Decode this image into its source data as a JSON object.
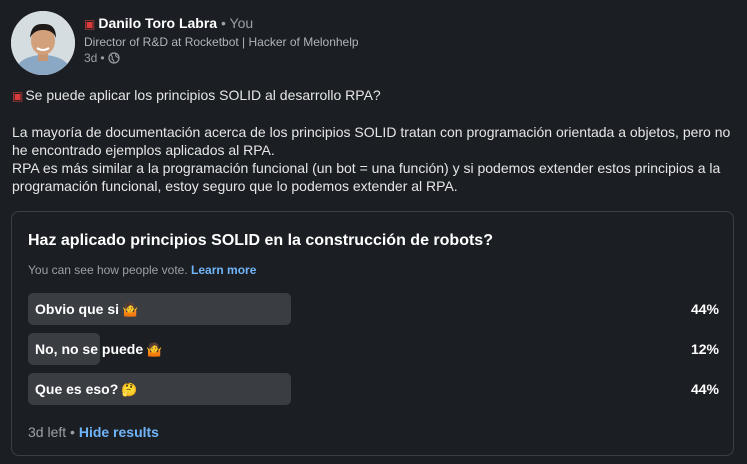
{
  "author": {
    "badge_icon": "robot-icon",
    "name": "Danilo Toro Labra",
    "separator": "•",
    "relation": "You",
    "headline": "Director of R&D at Rocketbot | Hacker of Melonhelp",
    "time": "3d",
    "visibility_icon": "globe-icon"
  },
  "post": {
    "question_icon": "robot-icon",
    "question": "Se puede aplicar los principios SOLID al desarrollo RPA?",
    "paragraph1": "La mayoría de documentación acerca de los principios SOLID tratan con programación orientada a objetos, pero no he encontrado ejemplos aplicados al RPA.",
    "paragraph2": "RPA es más similar a la programación funcional (un bot = una función) y si podemos extender estos principios a la programación funcional, estoy seguro que lo podemos extender al RPA."
  },
  "poll": {
    "question": "Haz aplicado principios SOLID en la construcción de robots?",
    "note": "You can see how people vote.",
    "note_link": "Learn more",
    "options": [
      {
        "label": "Obvio que si",
        "emoji": "🤷",
        "percent_label": "44%",
        "percent": 44
      },
      {
        "label": "No, no se puede",
        "emoji": "🤷",
        "percent_label": "12%",
        "percent": 12
      },
      {
        "label": "Que es eso?",
        "emoji": "🤔",
        "percent_label": "44%",
        "percent": 44
      }
    ],
    "time_left": "3d left",
    "footer_sep": "•",
    "hide_results": "Hide results"
  }
}
